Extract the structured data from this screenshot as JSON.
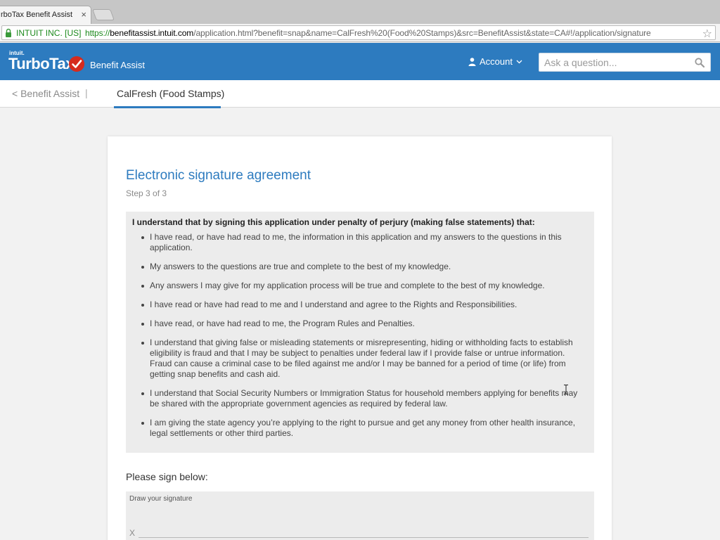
{
  "browser": {
    "tab_title": "rboTax Benefit Assist",
    "tab_close": "×",
    "ev_cert": "INTUIT INC. [US]",
    "url_scheme": "https://",
    "url_host": "benefitassist.intuit.com",
    "url_rest": "/application.html?benefit=snap&name=CalFresh%20(Food%20Stamps)&src=BenefitAssist&state=CA#!/application/signature",
    "star": "☆"
  },
  "header": {
    "brand_intuit": "intuit.",
    "brand_name": "TurboTax",
    "product": "Benefit Assist",
    "account_label": "Account",
    "search_placeholder": "Ask a question...",
    "brand_color": "#2d7bbf"
  },
  "subnav": {
    "back_label": "< Benefit Assist",
    "separator": "|",
    "active_tab": "CalFresh (Food Stamps)"
  },
  "agreement": {
    "title": "Electronic signature agreement",
    "step": "Step 3 of 3",
    "intro": "I understand that by signing this application under penalty of perjury (making false statements) that:",
    "items": [
      "I have read, or have had read to me, the information in this application and my answers to the questions in this application.",
      "My answers to the questions are true and complete to the best of my knowledge.",
      "Any answers I may give for my application process will be true and complete to the best of my knowledge.",
      "I have read or have had read to me and I understand and agree to the Rights and Responsibilities.",
      "I have read, or have had read to me, the Program Rules and Penalties.",
      "I understand that giving false or misleading statements or misrepresenting, hiding or withholding facts to establish eligibility is fraud and that I may be subject to penalties under federal law if I provide false or untrue information. Fraud can cause a criminal case to be filed against me and/or I may be banned for a period of time (or life) from getting snap benefits and cash aid.",
      "I understand that Social Security Numbers or Immigration Status for household members applying for benefits may be shared with the appropriate government agencies as required by federal law.",
      "I am giving the state agency you’re applying to the right to pursue and get any money from other health insurance, legal settlements or other third parties."
    ],
    "sign_label": "Please sign below:",
    "signature_hint": "Draw your signature",
    "signature_x": "X"
  }
}
